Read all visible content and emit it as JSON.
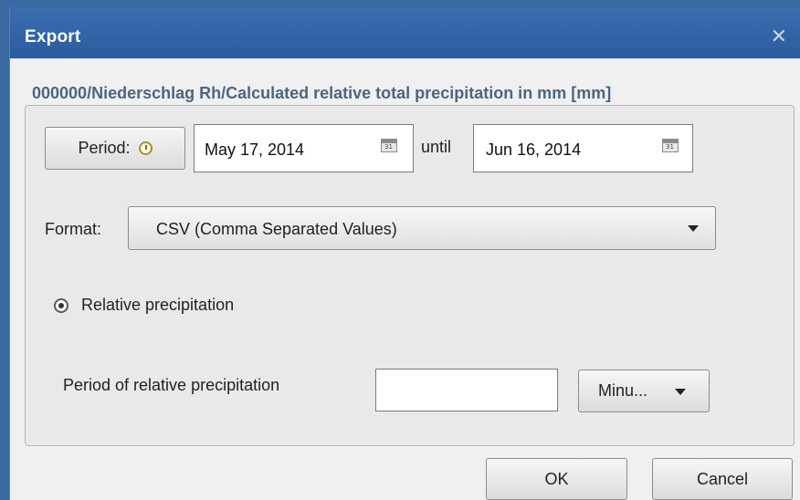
{
  "dialog": {
    "title": "Export",
    "close_glyph": "✕",
    "path_label": "000000/Niederschlag Rh/Calculated relative total precipitation in mm [mm]"
  },
  "period": {
    "button_label": "Period:",
    "button_icon": "clock-icon",
    "start_date": "May 17, 2014",
    "until_label": "until",
    "end_date": "Jun 16, 2014",
    "calendar_icon": "calendar-icon",
    "calendar_icon_text": "31"
  },
  "format": {
    "label": "Format:",
    "selected": "CSV (Comma Separated Values)"
  },
  "relative": {
    "radio_label": "Relative precipitation",
    "period_label": "Period of relative precipitation",
    "period_value": "",
    "unit_selected": "Minu..."
  },
  "footer": {
    "ok_label": "OK",
    "cancel_label": "Cancel"
  },
  "colors": {
    "titlebar": "#2b5c9e",
    "path_label": "#4b6680",
    "dialog_bg": "#f0f0f0"
  }
}
